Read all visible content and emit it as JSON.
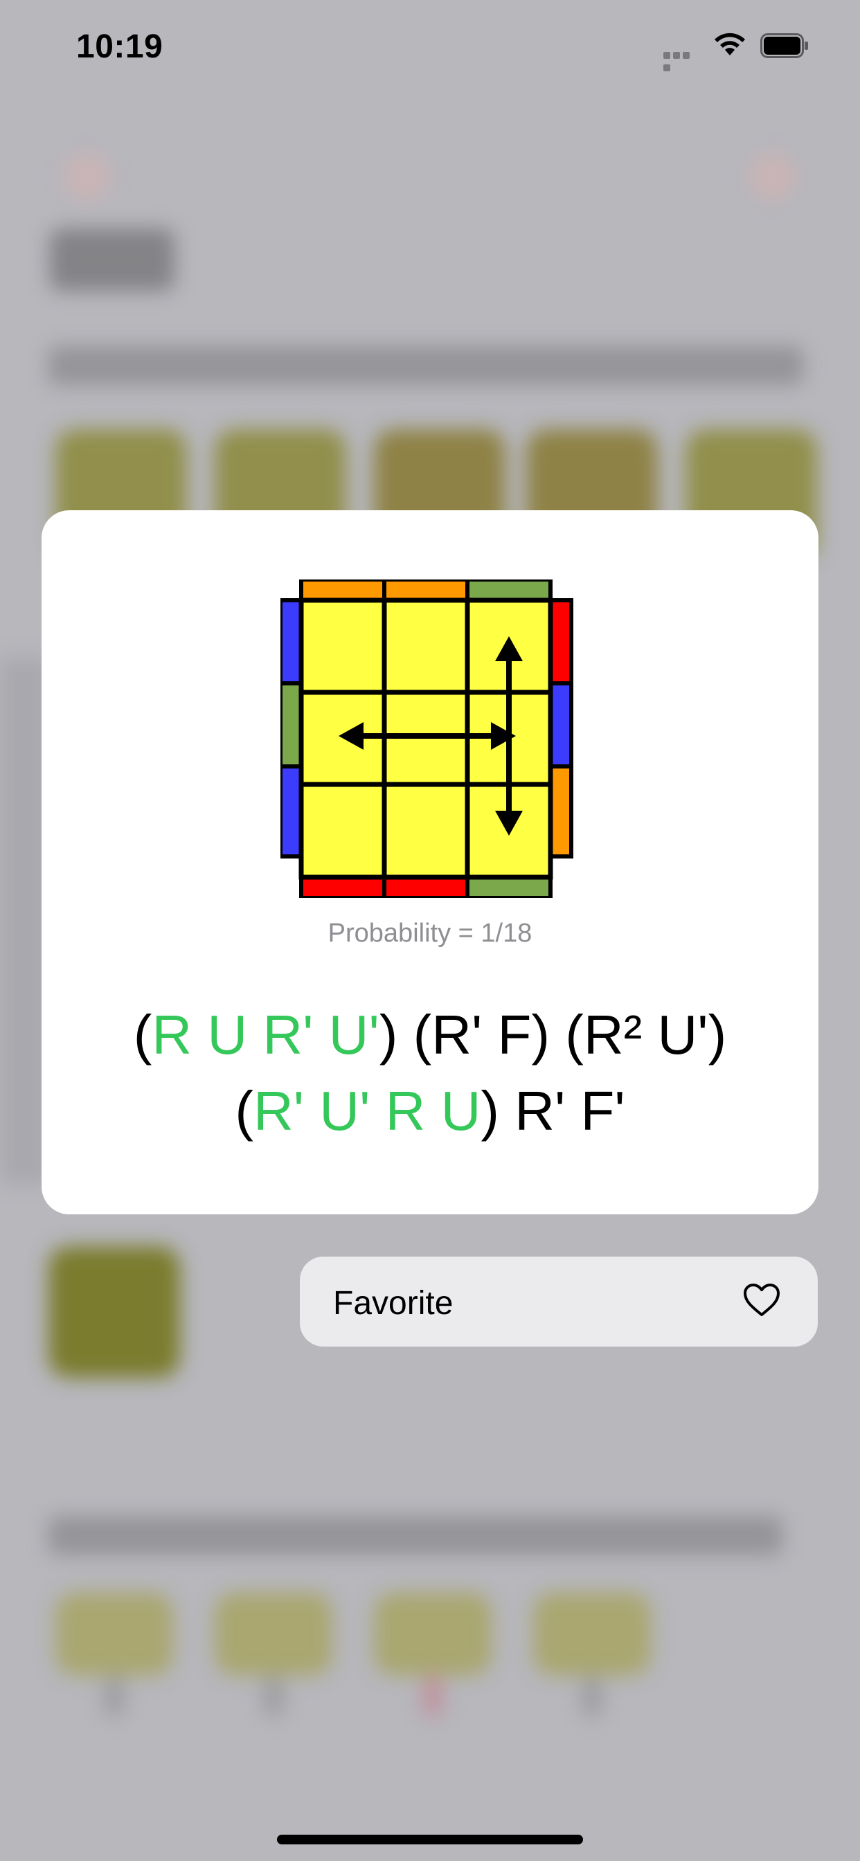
{
  "status_bar": {
    "time": "10:19"
  },
  "card": {
    "probability": "Probability = 1/18",
    "algorithm_line1": [
      {
        "t": "(",
        "c": "k"
      },
      {
        "t": "R U R' U'",
        "c": "g"
      },
      {
        "t": ") (R' F) (R² U')",
        "c": "k"
      }
    ],
    "algorithm_line2": [
      {
        "t": "(",
        "c": "k"
      },
      {
        "t": "R' U' R U",
        "c": "g"
      },
      {
        "t": ") R' F'",
        "c": "k"
      }
    ]
  },
  "favorite": {
    "label": "Favorite",
    "icon": "heart-icon"
  },
  "colors": {
    "yellow": "#ffff44",
    "orange": "#ff9900",
    "green": "#7ba84a",
    "blue": "#3c3cff",
    "red": "#ff0000",
    "accent_green": "#34c759"
  }
}
